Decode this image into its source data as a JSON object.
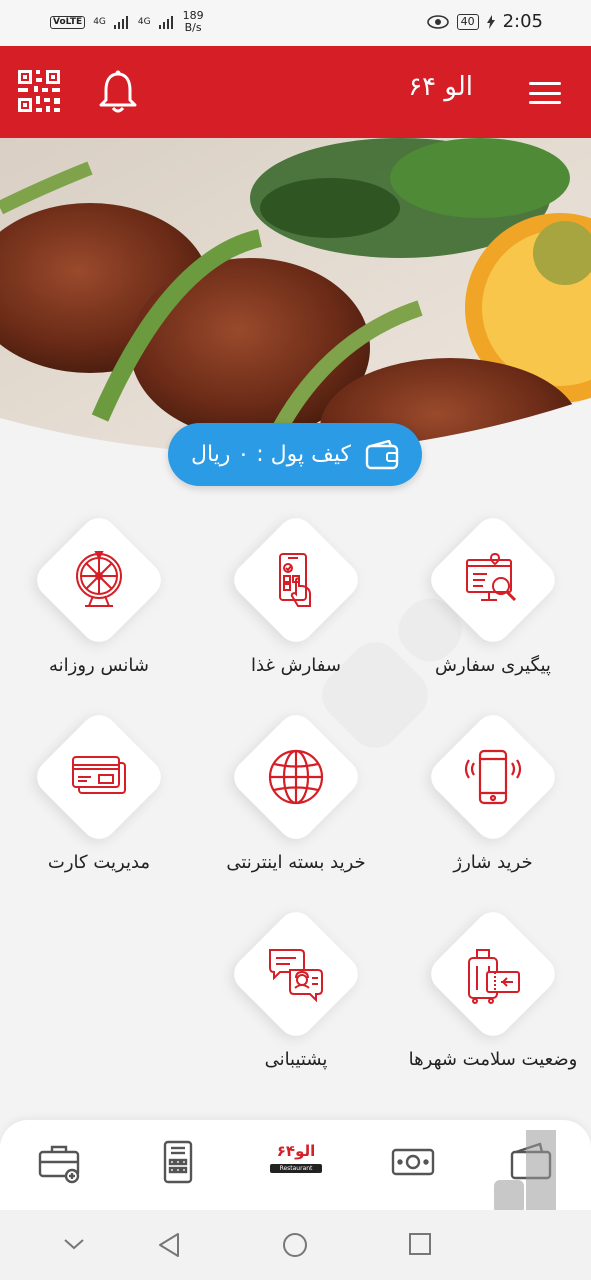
{
  "status_bar": {
    "volte": "VoLTE",
    "sig1": "4G",
    "sig2": "4G",
    "speed_value": "189",
    "speed_unit": "B/s",
    "battery": "40",
    "time": "2:05"
  },
  "header": {
    "title": "الو ۶۴",
    "qr_icon": "qr-code-icon",
    "bell_icon": "bell-icon",
    "menu_icon": "hamburger-menu-icon"
  },
  "wallet": {
    "label": "کیف پول : ۰ ریال",
    "icon": "wallet-icon"
  },
  "menu_items": [
    {
      "label": "پیگیری سفارش",
      "icon": "order-tracking-icon"
    },
    {
      "label": "سفارش غذا",
      "icon": "phone-order-icon"
    },
    {
      "label": "شانس روزانه",
      "icon": "wheel-of-fortune-icon"
    },
    {
      "label": "خرید شارژ",
      "icon": "mobile-phone-icon"
    },
    {
      "label": "خرید بسته اینترنتی",
      "icon": "globe-icon"
    },
    {
      "label": "مدیریت کارت",
      "icon": "bank-card-icon"
    },
    {
      "label": "وضعیت سلامت شهرها",
      "icon": "luggage-ticket-icon"
    },
    {
      "label": "پشتیبانی",
      "icon": "support-chat-icon"
    }
  ],
  "bottom_nav": {
    "logo_text": "الو۶۴",
    "logo_sub": "Restaurant"
  },
  "colors": {
    "primary": "#d51e26",
    "wallet": "#2b9be6"
  }
}
